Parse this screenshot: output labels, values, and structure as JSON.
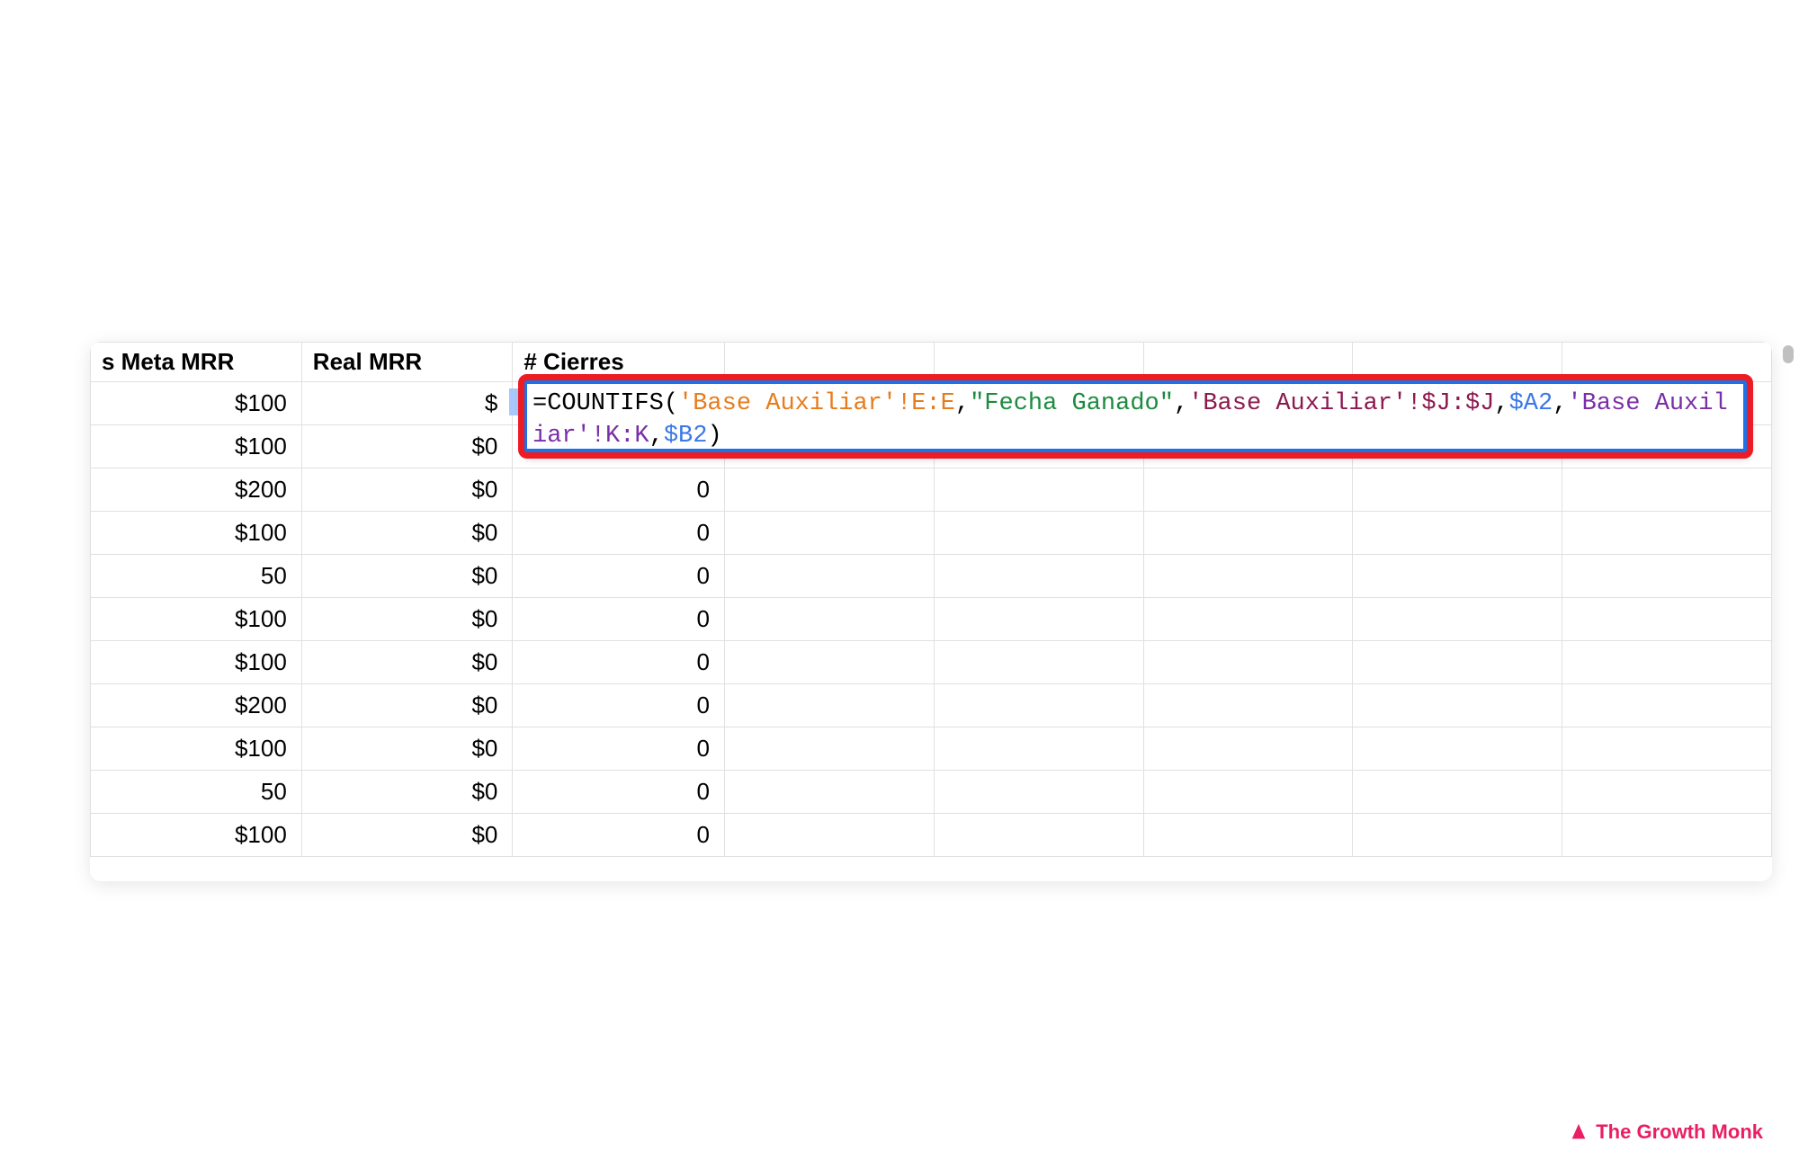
{
  "headers": {
    "meta_mrr": "s Meta MRR",
    "real_mrr": "Real MRR",
    "cierres": "# Cierres"
  },
  "rows": [
    {
      "meta": "$100",
      "real": "$",
      "cierres": ""
    },
    {
      "meta": "$100",
      "real": "$0",
      "cierres": ""
    },
    {
      "meta": "$200",
      "real": "$0",
      "cierres": "0"
    },
    {
      "meta": "$100",
      "real": "$0",
      "cierres": "0"
    },
    {
      "meta": "50",
      "real": "$0",
      "cierres": "0"
    },
    {
      "meta": "$100",
      "real": "$0",
      "cierres": "0"
    },
    {
      "meta": "$100",
      "real": "$0",
      "cierres": "0"
    },
    {
      "meta": "$200",
      "real": "$0",
      "cierres": "0"
    },
    {
      "meta": "$100",
      "real": "$0",
      "cierres": "0"
    },
    {
      "meta": "50",
      "real": "$0",
      "cierres": "0"
    },
    {
      "meta": "$100",
      "real": "$0",
      "cierres": "0"
    }
  ],
  "formula": {
    "eq": "=",
    "func": "COUNTIFS",
    "paren_open": "(",
    "ref1": "'Base Auxiliar'!E:E",
    "comma1": ",",
    "string1": "\"Fecha Ganado\"",
    "comma2": ",",
    "ref2": "'Base Auxiliar'!$J:$J",
    "comma3": ",",
    "ref3": "$A2",
    "comma4": ",",
    "ref4": "'Base Auxiliar'!K:K",
    "comma5": ",",
    "ref5": "$B2",
    "paren_close": ")"
  },
  "brand": {
    "name": "The Growth Monk"
  }
}
